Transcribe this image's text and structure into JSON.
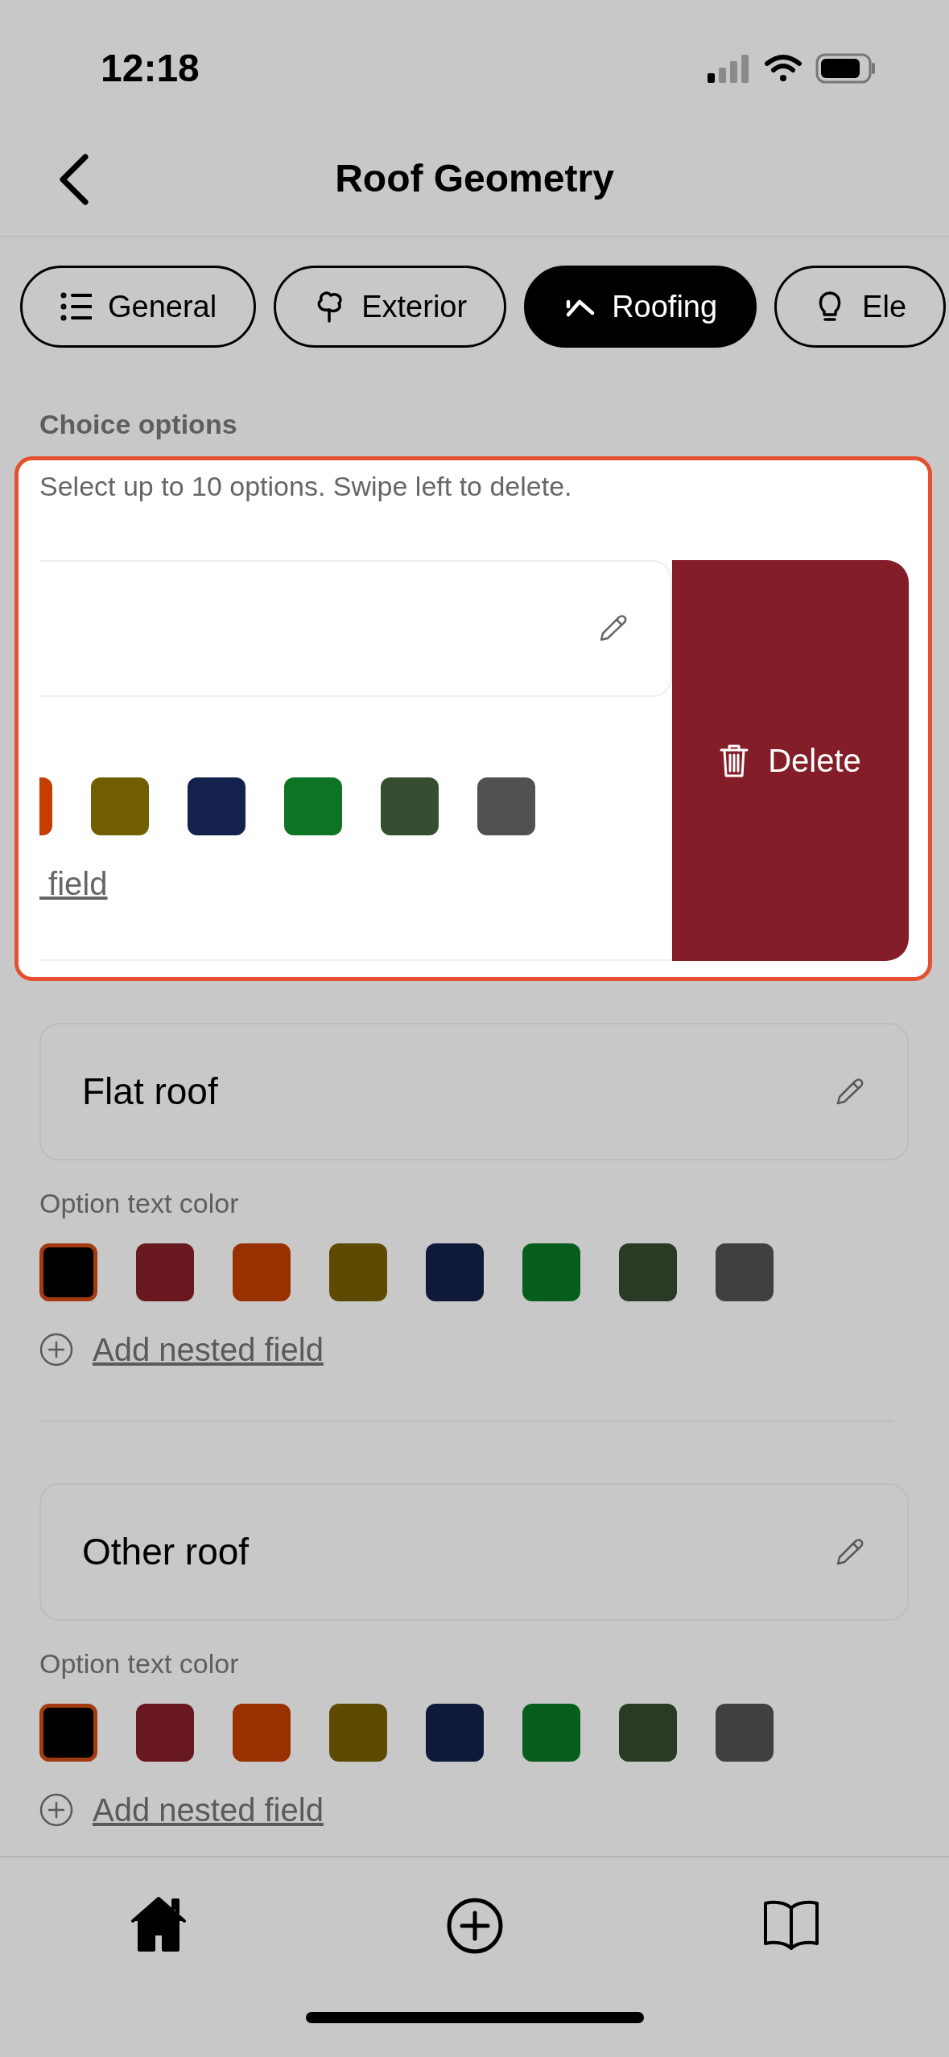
{
  "status_bar": {
    "time": "12:18"
  },
  "header": {
    "title": "Roof Geometry"
  },
  "tabs": [
    {
      "label": "General",
      "kind": "list",
      "selected": false
    },
    {
      "label": "Exterior",
      "kind": "tree",
      "selected": false
    },
    {
      "label": "Roofing",
      "kind": "roof",
      "selected": true
    },
    {
      "label": "Ele",
      "kind": "bulb",
      "selected": false
    }
  ],
  "choice_options": {
    "heading": "Choice options",
    "hint": "Select up to 10 options. Swipe left to delete.",
    "swiped_option": {
      "swatches": [
        {
          "color": "#c33e00",
          "selected": false
        },
        {
          "color": "#705e00",
          "selected": false
        },
        {
          "color": "#14214c",
          "selected": false
        },
        {
          "color": "#0c7423",
          "selected": false
        },
        {
          "color": "#374d31",
          "selected": false
        },
        {
          "color": "#525152",
          "selected": false
        }
      ],
      "add_link": " field",
      "delete_button": "Delete"
    },
    "options": [
      {
        "label": "Flat roof",
        "color_label": "Option text color",
        "swatches": [
          {
            "color": "#000000",
            "selected": true
          },
          {
            "color": "#6a1820",
            "selected": false
          },
          {
            "color": "#993000",
            "selected": false
          },
          {
            "color": "#5b4a00",
            "selected": false
          },
          {
            "color": "#0f1a3a",
            "selected": false
          },
          {
            "color": "#065e1d",
            "selected": false
          },
          {
            "color": "#2a3b25",
            "selected": false
          },
          {
            "color": "#414041",
            "selected": false
          }
        ],
        "add_link": "Add nested field"
      },
      {
        "label": "Other roof",
        "color_label": "Option text color",
        "swatches": [
          {
            "color": "#000000",
            "selected": true
          },
          {
            "color": "#6a1820",
            "selected": false
          },
          {
            "color": "#993000",
            "selected": false
          },
          {
            "color": "#5b4a00",
            "selected": false
          },
          {
            "color": "#0f1a3a",
            "selected": false
          },
          {
            "color": "#065e1d",
            "selected": false
          },
          {
            "color": "#2a3b25",
            "selected": false
          },
          {
            "color": "#414041",
            "selected": false
          }
        ],
        "add_link": "Add nested field"
      }
    ]
  },
  "bottom_nav": [
    {
      "kind": "home",
      "selected": true
    },
    {
      "kind": "add",
      "selected": false
    },
    {
      "kind": "book",
      "selected": false
    }
  ]
}
